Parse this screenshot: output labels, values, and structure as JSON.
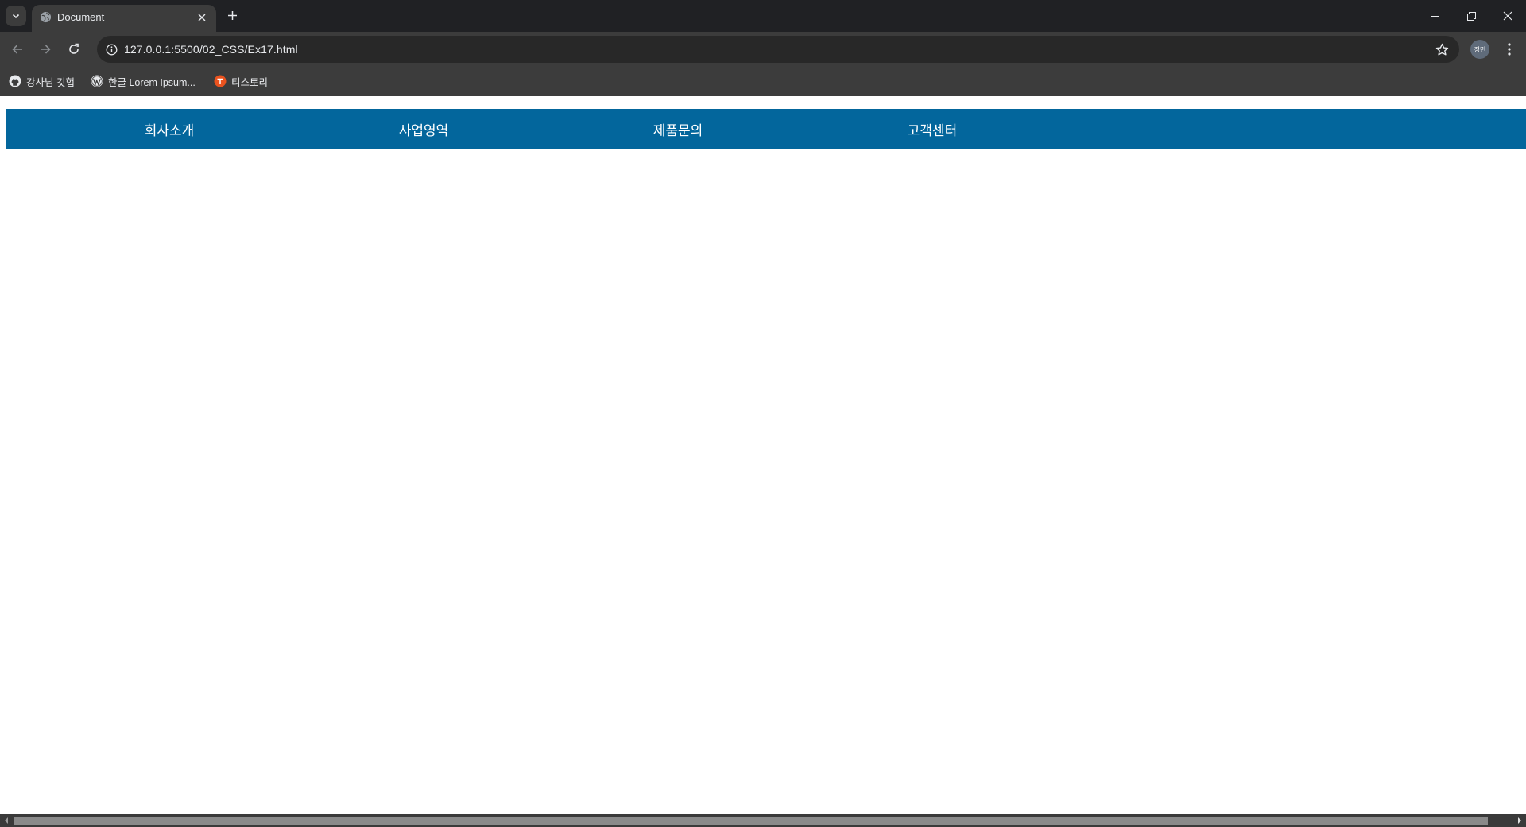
{
  "browser": {
    "tab": {
      "title": "Document"
    },
    "address": {
      "url": "127.0.0.1:5500/02_CSS/Ex17.html"
    },
    "profile": {
      "label": "정민"
    },
    "bookmarks": [
      {
        "label": "강사님 깃헙",
        "icon": "github-icon"
      },
      {
        "label": "한글 Lorem Ipsum...",
        "icon": "wordpress-icon"
      },
      {
        "label": "티스토리",
        "icon": "tistory-icon"
      }
    ]
  },
  "page": {
    "menu": [
      {
        "label": "회사소개"
      },
      {
        "label": "사업영역"
      },
      {
        "label": "제품문의"
      },
      {
        "label": "고객센터"
      }
    ],
    "menu_color": "#03669c"
  }
}
